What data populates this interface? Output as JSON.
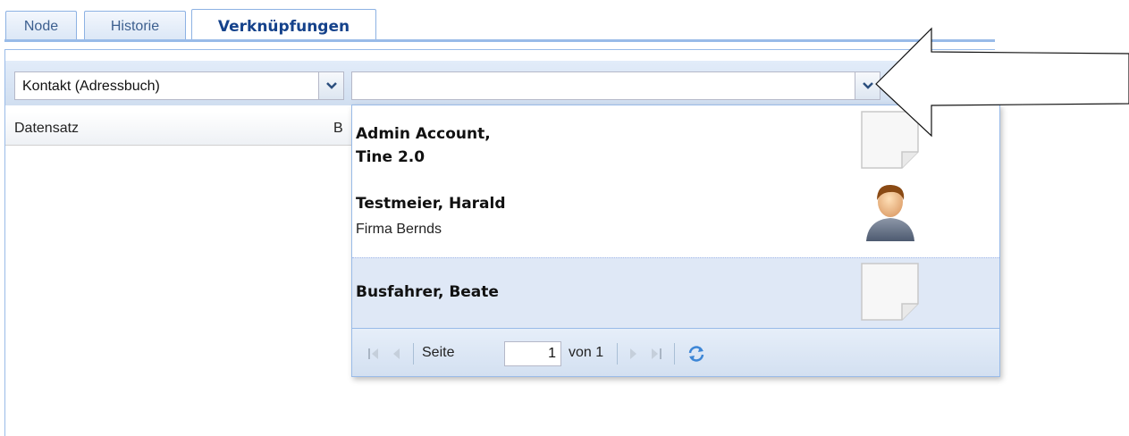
{
  "tabs": [
    {
      "label": "Node",
      "active": false
    },
    {
      "label": "Historie",
      "active": false
    },
    {
      "label": "Verknüpfungen",
      "active": true
    }
  ],
  "toolbar": {
    "type_combo": {
      "value": "Kontakt (Adressbuch)"
    },
    "search_combo": {
      "value": ""
    }
  },
  "grid": {
    "columns": [
      "Datensatz",
      "B"
    ]
  },
  "dropdown": {
    "items": [
      {
        "name": "Admin Account,",
        "name2": "Tine 2.0",
        "sub": "",
        "icon": "document-icon",
        "selected": false
      },
      {
        "name": "Testmeier, Harald",
        "name2": "",
        "sub": "Firma Bernds",
        "icon": "person-avatar-icon",
        "selected": false
      },
      {
        "name": "Busfahrer, Beate",
        "name2": "",
        "sub": "",
        "icon": "document-icon",
        "selected": true
      }
    ],
    "pager": {
      "page_label": "Seite",
      "page_value": "1",
      "of_label": "von 1"
    }
  },
  "colors": {
    "accent": "#15428b",
    "border": "#99bbe8",
    "selected_row": "#dfe8f6"
  }
}
